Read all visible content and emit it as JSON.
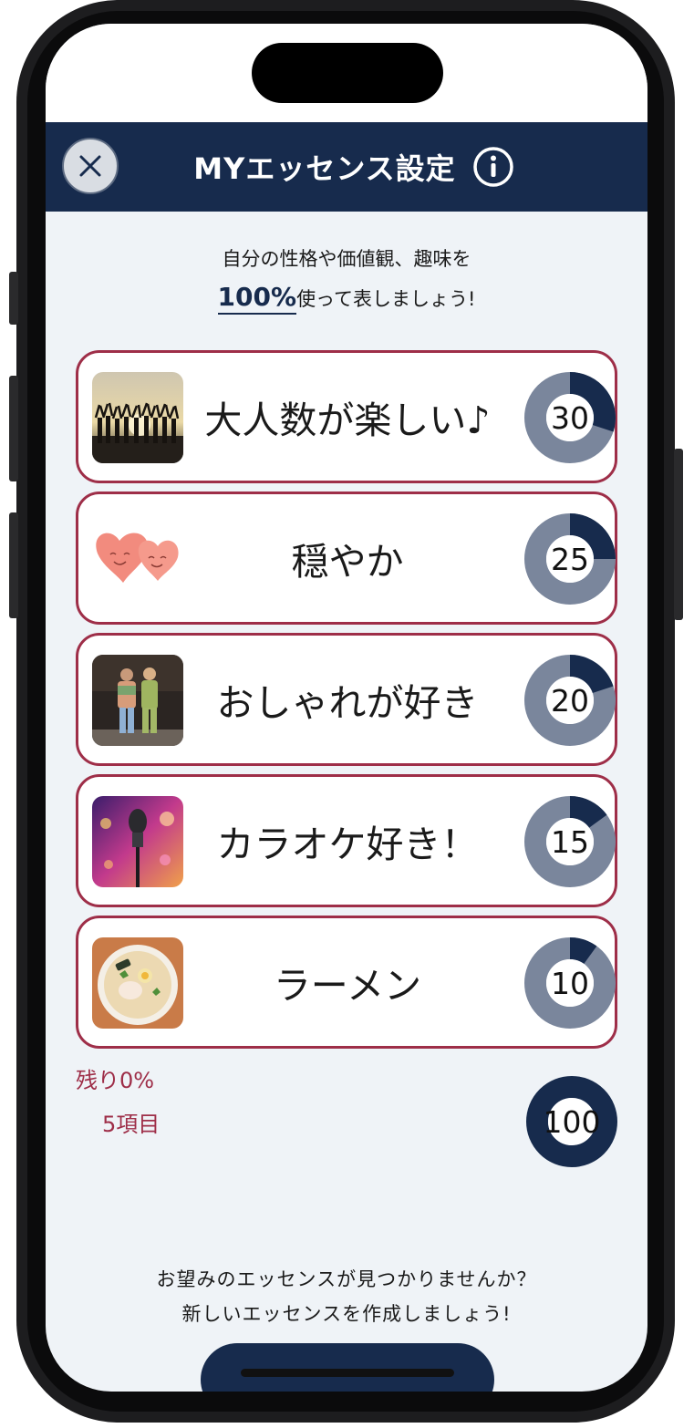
{
  "header": {
    "title": "MYエッセンス設定"
  },
  "intro": {
    "line1": "自分の性格や価値観、趣味を",
    "highlight": "100%",
    "line2_rest": "使って表しましょう!"
  },
  "essences": [
    {
      "label": "大人数が楽しい♪",
      "value": 30,
      "percent": 30,
      "thumbnail": "crowd-silhouette-photo"
    },
    {
      "label": "穏やか",
      "value": 25,
      "percent": 25,
      "thumbnail": "smiling-hearts-illustration"
    },
    {
      "label": "おしゃれが好き",
      "value": 20,
      "percent": 20,
      "thumbnail": "fashion-couple-photo"
    },
    {
      "label": "カラオケ好き！",
      "value": 15,
      "percent": 15,
      "thumbnail": "microphone-photo"
    },
    {
      "label": "ラーメン",
      "value": 10,
      "percent": 10,
      "thumbnail": "ramen-photo"
    }
  ],
  "summary": {
    "remaining": "残り0%",
    "item_count": "5項目",
    "total": "100",
    "total_percent": 100
  },
  "footer": {
    "line1": "お望みのエッセンスが見つかりませんか？",
    "line2": "新しいエッセンスを作成しましょう!"
  },
  "colors": {
    "navy": "#172b4d",
    "accent_border": "#9e2e48",
    "ring_track": "#7a869c",
    "background": "#eff3f7"
  },
  "icons": {
    "close": "close-icon",
    "info": "info-icon"
  }
}
